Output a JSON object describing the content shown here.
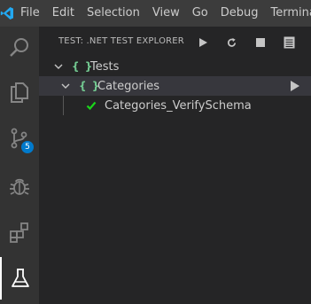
{
  "menu": {
    "items": [
      "File",
      "Edit",
      "Selection",
      "View",
      "Go",
      "Debug",
      "Terminal"
    ]
  },
  "activity_bar": {
    "items": [
      {
        "icon": "search-icon"
      },
      {
        "icon": "files-icon"
      },
      {
        "icon": "source-control-icon",
        "badge": "5"
      },
      {
        "icon": "debug-icon"
      },
      {
        "icon": "extensions-icon"
      },
      {
        "icon": "test-flask-icon",
        "active": true
      }
    ]
  },
  "sidebar": {
    "title": "TEST: .NET TEST EXPLORER",
    "actions": [
      "run-all-icon",
      "refresh-icon",
      "stop-icon",
      "log-icon"
    ]
  },
  "tree": {
    "root": {
      "prefix": "{ }",
      "label": "Tests"
    },
    "group": {
      "prefix": "{ }",
      "label": "Categories"
    },
    "test": {
      "label": "Categories_VerifySchema",
      "status": "passed"
    }
  },
  "colors": {
    "accent": "#007acc",
    "namespace": "#73c991",
    "passed": "#1ad61a",
    "selected_row": "#37373d"
  }
}
